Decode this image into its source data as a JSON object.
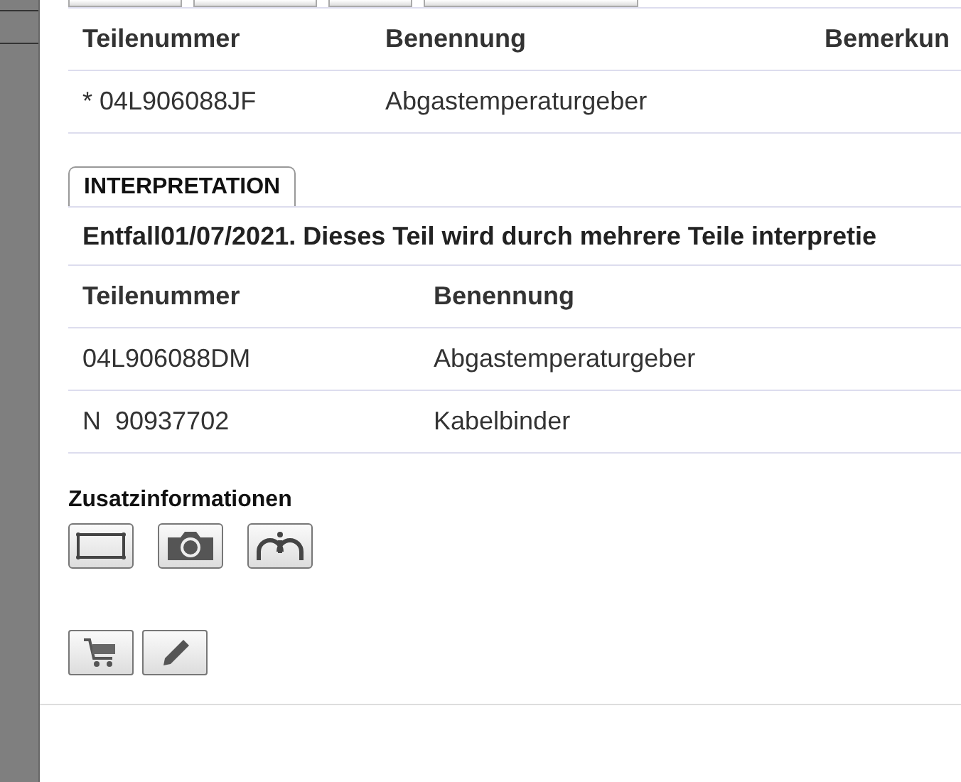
{
  "parts_table": {
    "columns": [
      "Teilenummer",
      "Benennung",
      "Bemerkun"
    ],
    "rows": [
      {
        "cells": [
          "* 04L906088JF",
          "Abgastemperaturgeber",
          ""
        ]
      }
    ]
  },
  "interpretation": {
    "tab": "INTERPRETATION",
    "note": "Entfall01/07/2021. Dieses Teil wird durch mehrere Teile interpretie",
    "columns": [
      "Teilenummer",
      "Benennung"
    ],
    "rows": [
      {
        "cells": [
          "04L906088DM",
          "Abgastemperaturgeber"
        ]
      },
      {
        "cells": [
          "N  90937702",
          "Kabelbinder"
        ]
      }
    ]
  },
  "additional_info": {
    "title": "Zusatzinformationen",
    "buttons": [
      {
        "kind": "frame"
      },
      {
        "kind": "camera"
      },
      {
        "kind": "info"
      }
    ]
  },
  "actions": [
    {
      "kind": "cart"
    },
    {
      "kind": "pencil"
    }
  ]
}
